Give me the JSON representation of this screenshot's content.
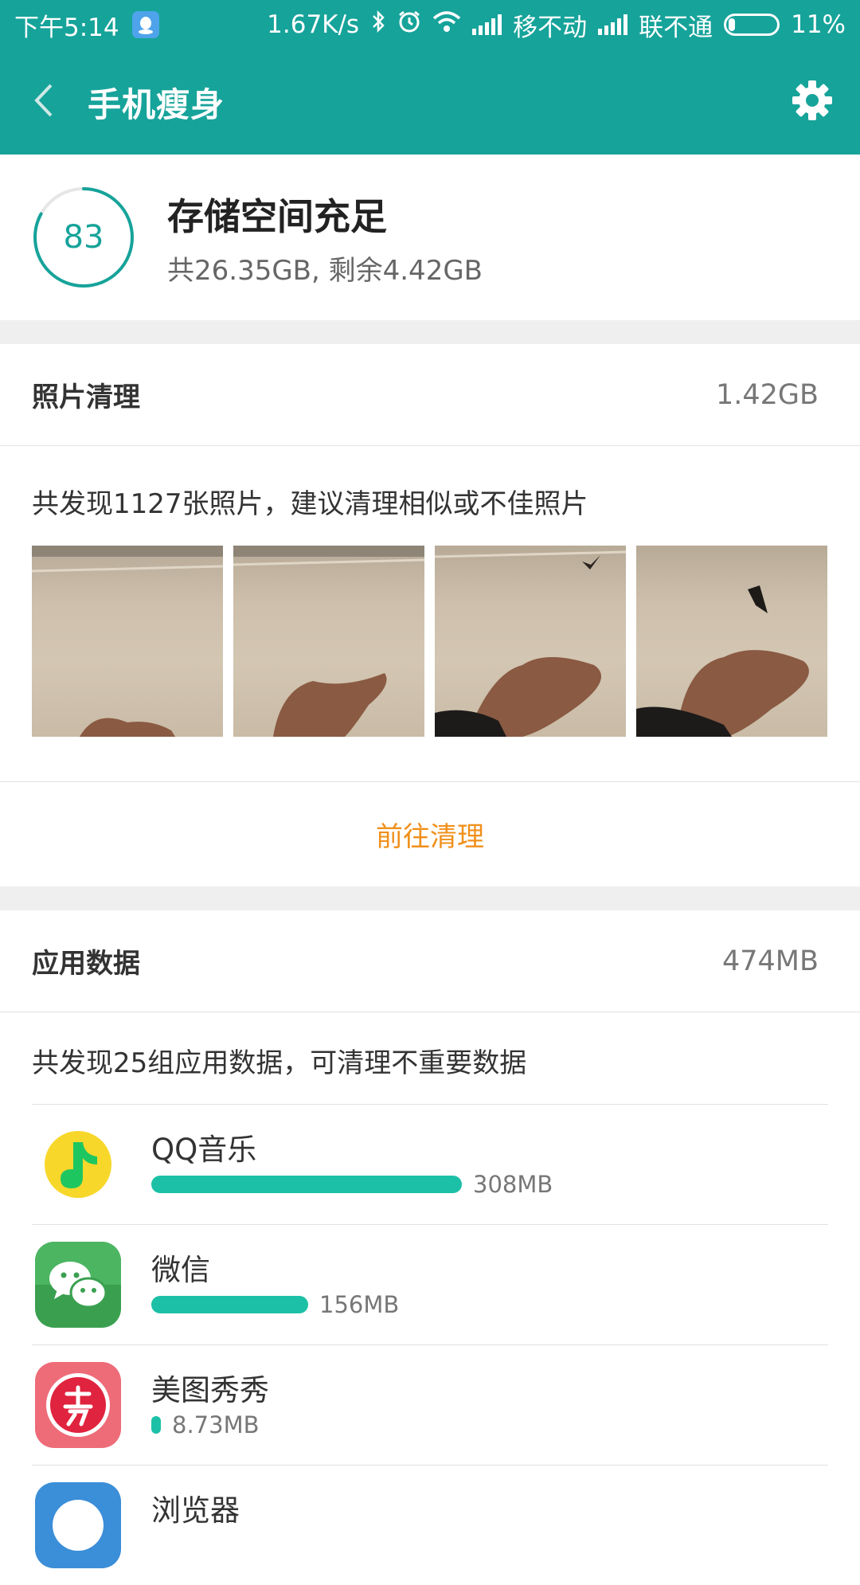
{
  "status_bar": {
    "time": "下午5:14",
    "speed": "1.67K/s",
    "carrier1": "移不动",
    "carrier2": "联不通",
    "battery": "11%"
  },
  "header": {
    "title": "手机瘦身",
    "back_icon": "chevron-left-icon",
    "settings_icon": "gear-icon"
  },
  "storage": {
    "score": "83",
    "score_fraction": 0.83,
    "title": "存储空间充足",
    "detail": "共26.35GB, 剩余4.42GB"
  },
  "photo_clean": {
    "label": "照片清理",
    "size": "1.42GB",
    "description": "共发现1127张照片，建议清理相似或不佳照片",
    "action": "前往清理"
  },
  "app_data": {
    "label": "应用数据",
    "size": "474MB",
    "description": "共发现25组应用数据，可清理不重要数据",
    "apps": [
      {
        "name": "QQ音乐",
        "size": "308MB",
        "usage_fraction": 1.0
      },
      {
        "name": "微信",
        "size": "156MB",
        "usage_fraction": 0.506
      },
      {
        "name": "美图秀秀",
        "size": "8.73MB",
        "usage_fraction": 0.03
      },
      {
        "name": "浏览器",
        "size": "",
        "usage_fraction": 0
      }
    ]
  },
  "colors": {
    "accent": "#16a39a",
    "bar": "#1cc0a6",
    "action": "#f0901b"
  }
}
